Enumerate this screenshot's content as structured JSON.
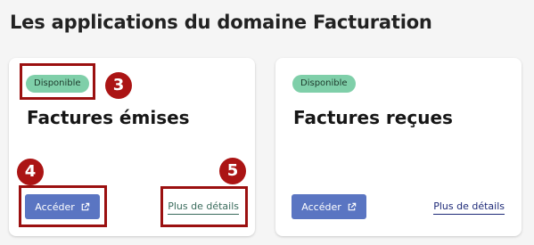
{
  "page": {
    "title": "Les applications du domaine Facturation"
  },
  "cards": [
    {
      "status": "Disponible",
      "title": "Factures émises",
      "access_label": "Accéder",
      "details_label": "Plus de détails"
    },
    {
      "status": "Disponible",
      "title": "Factures reçues",
      "access_label": "Accéder",
      "details_label": "Plus de détails"
    }
  ],
  "annotations": {
    "marker_3": "3",
    "marker_4": "4",
    "marker_5": "5"
  },
  "colors": {
    "badge_bg": "#7fcfa9",
    "button_bg": "#5a75c2",
    "annotation_red": "#ab1414",
    "link_blue": "#1e2a78"
  },
  "icons": {
    "access_button_icon": "external-link-icon"
  }
}
